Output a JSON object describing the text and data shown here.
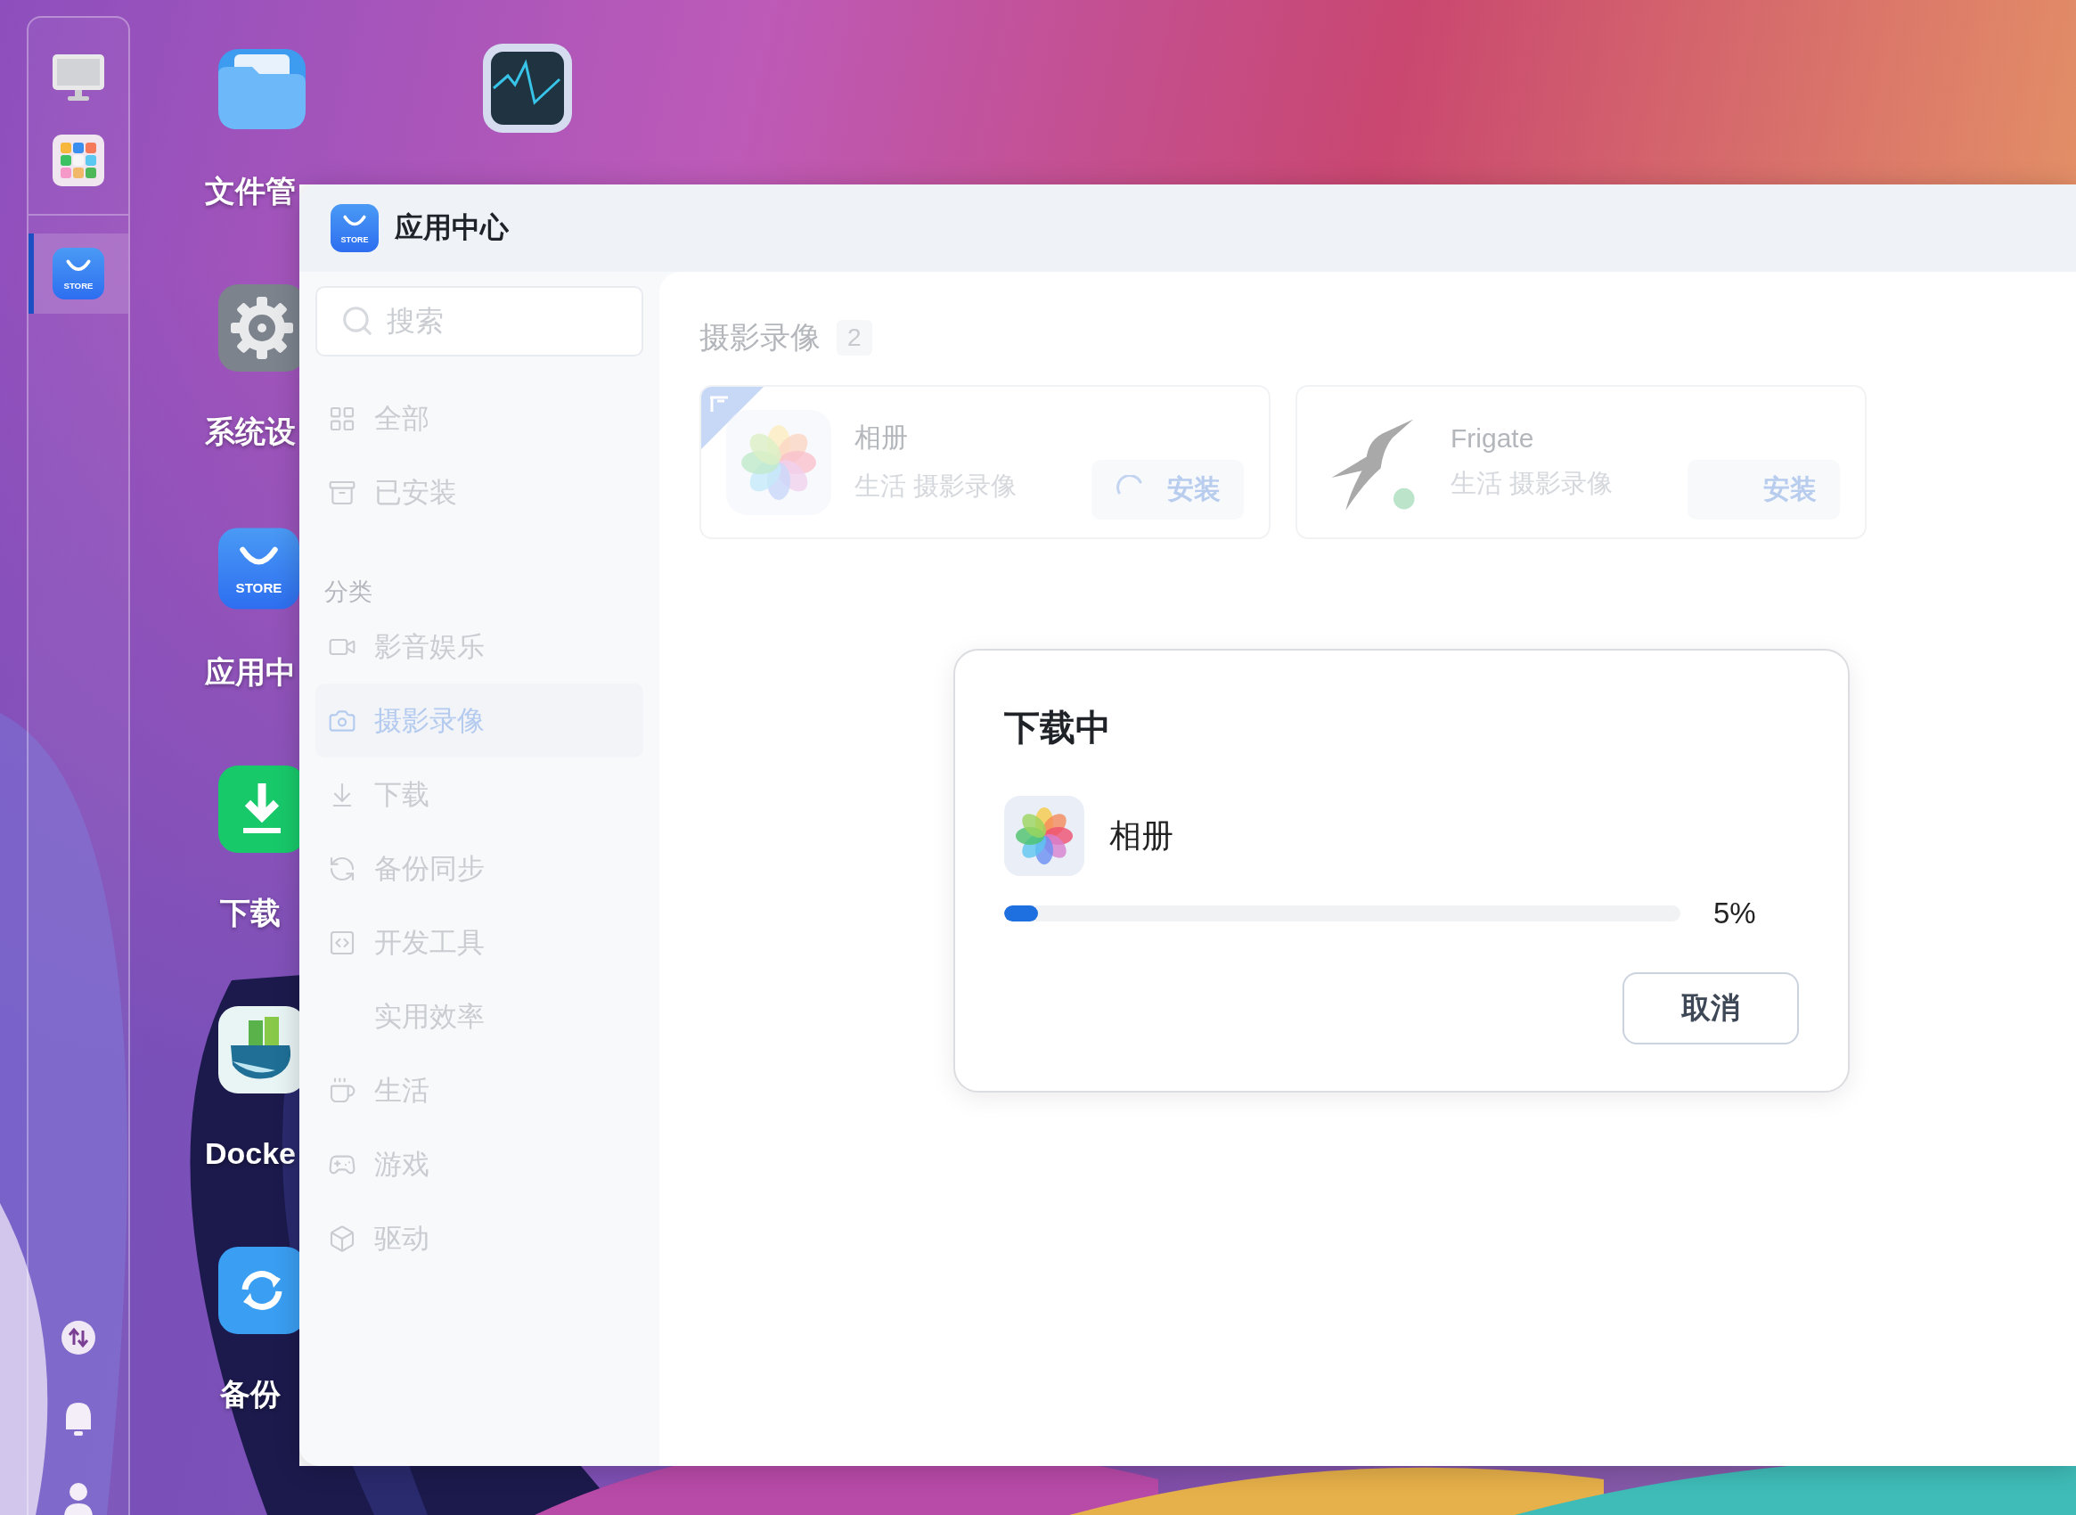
{
  "dock": {
    "items": [
      {
        "kind": "monitor",
        "selected": false
      },
      {
        "kind": "apps",
        "selected": false
      },
      {
        "kind": "store",
        "selected": true,
        "logo_text": "STORE"
      }
    ]
  },
  "desktop": {
    "icons": [
      {
        "kind": "folder",
        "label": "文件管"
      },
      {
        "kind": "gear",
        "label": "系统设"
      },
      {
        "kind": "store",
        "label": "应用中",
        "logo_text": "STORE"
      },
      {
        "kind": "download",
        "label": "下载"
      },
      {
        "kind": "whale",
        "label": "Docke"
      },
      {
        "kind": "backup",
        "label": "备份"
      },
      {
        "kind": "activity"
      }
    ]
  },
  "window": {
    "title": "应用中心",
    "logo_text": "STORE",
    "search": {
      "placeholder": "搜索"
    },
    "nav": [
      {
        "kind": "grid",
        "label": "全部",
        "selected": false
      },
      {
        "kind": "archive",
        "label": "已安装",
        "selected": false
      }
    ],
    "category_heading": "分类",
    "categories": [
      {
        "kind": "video",
        "label": "影音娱乐",
        "selected": false
      },
      {
        "kind": "camera",
        "label": "摄影录像",
        "selected": true
      },
      {
        "kind": "download",
        "label": "下载",
        "selected": false
      },
      {
        "kind": "sync",
        "label": "备份同步",
        "selected": false
      },
      {
        "kind": "code",
        "label": "开发工具",
        "selected": false
      },
      {
        "kind": "plain",
        "label": "实用效率",
        "selected": false
      },
      {
        "kind": "cup",
        "label": "生活",
        "selected": false
      },
      {
        "kind": "gamepad",
        "label": "游戏",
        "selected": false
      },
      {
        "kind": "box",
        "label": "驱动",
        "selected": false
      }
    ],
    "content": {
      "heading": "摄影录像",
      "count": "2",
      "apps": [
        {
          "kind": "flower",
          "name": "相册",
          "tags": "生活 摄影录像",
          "button": "安装",
          "installing": true,
          "featured": true
        },
        {
          "kind": "bird",
          "name": "Frigate",
          "tags": "生活 摄影录像",
          "button": "安装",
          "installing": false,
          "featured": false
        }
      ]
    }
  },
  "dialog": {
    "title": "下载中",
    "app": {
      "kind": "flower",
      "name": "相册"
    },
    "progress": {
      "level": 0.05,
      "reading": "5%"
    },
    "buttons": [
      "取消"
    ]
  }
}
